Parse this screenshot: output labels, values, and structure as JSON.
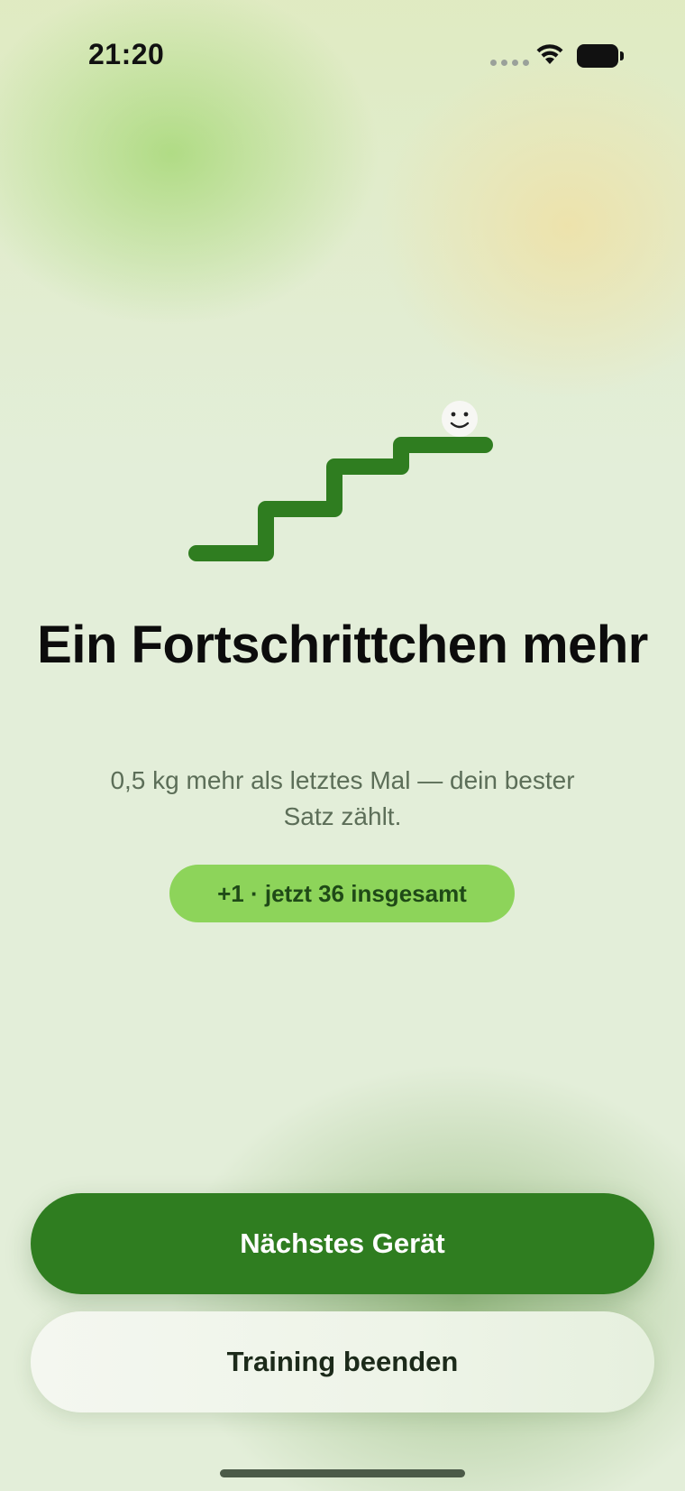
{
  "status_bar": {
    "time": "21:20",
    "wifi_icon": "wifi-icon",
    "battery_icon": "battery-icon"
  },
  "illustration": {
    "icon": "stairs-progress-icon",
    "face_icon": "smiley-face-icon",
    "stair_color": "#2f7d20"
  },
  "headline": "Ein Fortschrittchen mehr",
  "subline": "0,5 kg mehr als letztes Mal — dein bester Satz zählt.",
  "badge": {
    "label": "+1 · jetzt 36 insgesamt",
    "color": "#8dd45a"
  },
  "actions": {
    "primary_label": "Nächstes Gerät",
    "secondary_label": "Training beenden"
  },
  "colors": {
    "accent": "#2f7d20",
    "background": "#e3eed9"
  }
}
